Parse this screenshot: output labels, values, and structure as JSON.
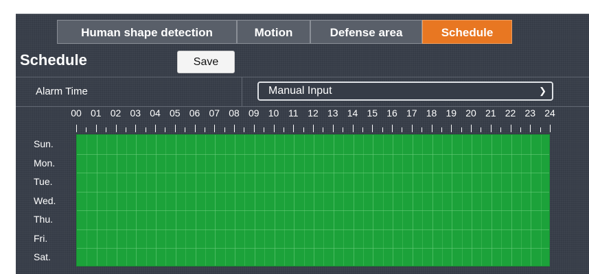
{
  "tabs": [
    {
      "label": "Human shape detection",
      "active": false
    },
    {
      "label": "Motion",
      "active": false
    },
    {
      "label": "Defense area",
      "active": false
    },
    {
      "label": "Schedule",
      "active": true
    }
  ],
  "title": "Schedule",
  "save_label": "Save",
  "alarm_time": {
    "label": "Alarm Time",
    "selected": "Manual Input"
  },
  "hours": [
    "00",
    "01",
    "02",
    "03",
    "04",
    "05",
    "06",
    "07",
    "08",
    "09",
    "10",
    "11",
    "12",
    "13",
    "14",
    "15",
    "16",
    "17",
    "18",
    "19",
    "20",
    "21",
    "22",
    "23",
    "24"
  ],
  "days": [
    "Sun.",
    "Mon.",
    "Tue.",
    "Wed.",
    "Thu.",
    "Fri.",
    "Sat."
  ],
  "schedule_fill": "all hours enabled",
  "colors": {
    "panel": "#363c47",
    "active_tab": "#e87722",
    "schedule_enabled": "#1ca23a"
  }
}
